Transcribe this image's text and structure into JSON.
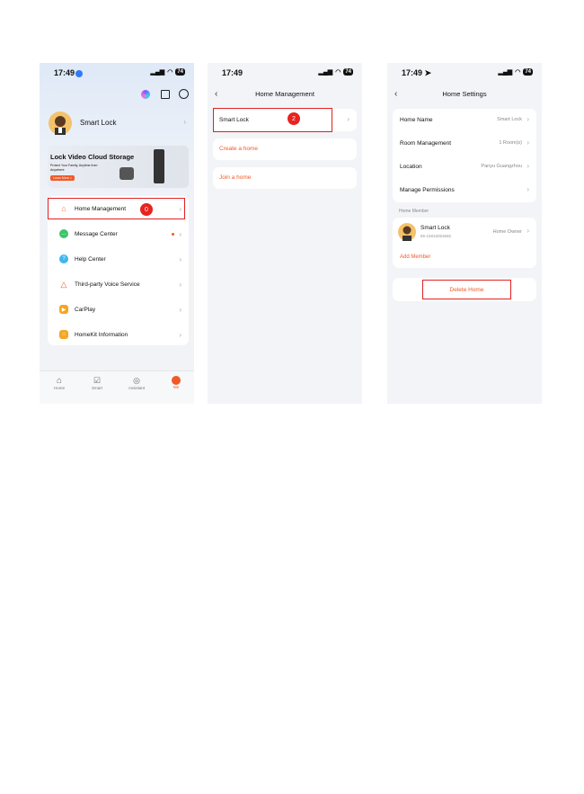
{
  "screen1": {
    "time": "17:49",
    "battery": "74",
    "profile_name": "Smart Lock",
    "banner": {
      "title": "Lock Video Cloud Storage",
      "subtitle": "Protect Your Family, Anytime from Anywhere",
      "cta": "Learn More >"
    },
    "menu": [
      {
        "label": "Home Management",
        "icon": "home-icon",
        "color": "#f47a4a"
      },
      {
        "label": "Message Center",
        "icon": "message-icon",
        "color": "#3ec46d"
      },
      {
        "label": "Help Center",
        "icon": "help-icon",
        "color": "#3eb6f0"
      },
      {
        "label": "Third-party Voice Service",
        "icon": "voice-icon",
        "color": "#f05a28"
      },
      {
        "label": "CarPlay",
        "icon": "carplay-icon",
        "color": "#f5a623"
      },
      {
        "label": "HomeKit Information",
        "icon": "homekit-icon",
        "color": "#f5a623"
      }
    ],
    "step_badge": "0",
    "tabs": [
      {
        "label": "Home",
        "icon": "home-tab-icon"
      },
      {
        "label": "Smart",
        "icon": "smart-tab-icon"
      },
      {
        "label": "Assistant",
        "icon": "assistant-tab-icon"
      },
      {
        "label": "Me",
        "icon": "me-tab-icon"
      }
    ]
  },
  "screen2": {
    "time": "17:49",
    "title": "Home Management",
    "home_item": "Smart Lock",
    "step_badge": "2",
    "create": "Create a home",
    "join": "Join a home"
  },
  "screen3": {
    "time": "17:49",
    "title": "Home Settings",
    "rows": [
      {
        "key": "Home Name",
        "value": "Smart Lock"
      },
      {
        "key": "Room Management",
        "value": "1 Room(s)"
      },
      {
        "key": "Location",
        "value": "Panyu Guangzhou"
      },
      {
        "key": "Manage Permissions",
        "value": ""
      }
    ],
    "member_section": "Home Member",
    "member_name": "Smart Lock",
    "member_phone": "86-15816053665",
    "member_role": "Home Owner",
    "add_member": "Add Member",
    "delete": "Delete Home"
  },
  "colors": {
    "accent": "#f05a28",
    "highlight": "#e02020"
  }
}
